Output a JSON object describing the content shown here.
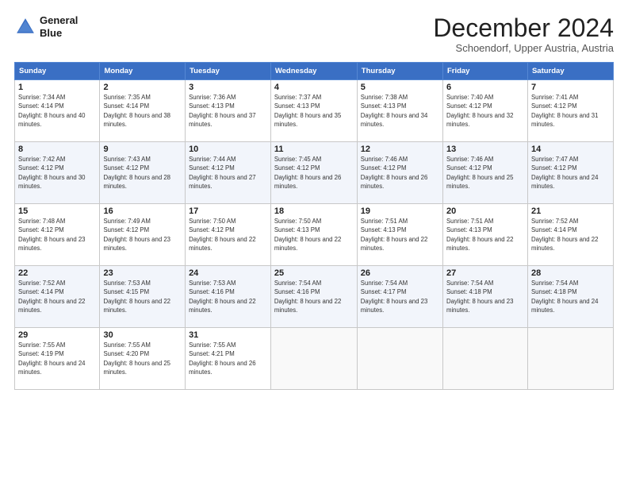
{
  "header": {
    "logo_line1": "General",
    "logo_line2": "Blue",
    "month": "December 2024",
    "location": "Schoendorf, Upper Austria, Austria"
  },
  "weekdays": [
    "Sunday",
    "Monday",
    "Tuesday",
    "Wednesday",
    "Thursday",
    "Friday",
    "Saturday"
  ],
  "rows": [
    [
      {
        "day": "1",
        "sunrise": "Sunrise: 7:34 AM",
        "sunset": "Sunset: 4:14 PM",
        "daylight": "Daylight: 8 hours and 40 minutes."
      },
      {
        "day": "2",
        "sunrise": "Sunrise: 7:35 AM",
        "sunset": "Sunset: 4:14 PM",
        "daylight": "Daylight: 8 hours and 38 minutes."
      },
      {
        "day": "3",
        "sunrise": "Sunrise: 7:36 AM",
        "sunset": "Sunset: 4:13 PM",
        "daylight": "Daylight: 8 hours and 37 minutes."
      },
      {
        "day": "4",
        "sunrise": "Sunrise: 7:37 AM",
        "sunset": "Sunset: 4:13 PM",
        "daylight": "Daylight: 8 hours and 35 minutes."
      },
      {
        "day": "5",
        "sunrise": "Sunrise: 7:38 AM",
        "sunset": "Sunset: 4:13 PM",
        "daylight": "Daylight: 8 hours and 34 minutes."
      },
      {
        "day": "6",
        "sunrise": "Sunrise: 7:40 AM",
        "sunset": "Sunset: 4:12 PM",
        "daylight": "Daylight: 8 hours and 32 minutes."
      },
      {
        "day": "7",
        "sunrise": "Sunrise: 7:41 AM",
        "sunset": "Sunset: 4:12 PM",
        "daylight": "Daylight: 8 hours and 31 minutes."
      }
    ],
    [
      {
        "day": "8",
        "sunrise": "Sunrise: 7:42 AM",
        "sunset": "Sunset: 4:12 PM",
        "daylight": "Daylight: 8 hours and 30 minutes."
      },
      {
        "day": "9",
        "sunrise": "Sunrise: 7:43 AM",
        "sunset": "Sunset: 4:12 PM",
        "daylight": "Daylight: 8 hours and 28 minutes."
      },
      {
        "day": "10",
        "sunrise": "Sunrise: 7:44 AM",
        "sunset": "Sunset: 4:12 PM",
        "daylight": "Daylight: 8 hours and 27 minutes."
      },
      {
        "day": "11",
        "sunrise": "Sunrise: 7:45 AM",
        "sunset": "Sunset: 4:12 PM",
        "daylight": "Daylight: 8 hours and 26 minutes."
      },
      {
        "day": "12",
        "sunrise": "Sunrise: 7:46 AM",
        "sunset": "Sunset: 4:12 PM",
        "daylight": "Daylight: 8 hours and 26 minutes."
      },
      {
        "day": "13",
        "sunrise": "Sunrise: 7:46 AM",
        "sunset": "Sunset: 4:12 PM",
        "daylight": "Daylight: 8 hours and 25 minutes."
      },
      {
        "day": "14",
        "sunrise": "Sunrise: 7:47 AM",
        "sunset": "Sunset: 4:12 PM",
        "daylight": "Daylight: 8 hours and 24 minutes."
      }
    ],
    [
      {
        "day": "15",
        "sunrise": "Sunrise: 7:48 AM",
        "sunset": "Sunset: 4:12 PM",
        "daylight": "Daylight: 8 hours and 23 minutes."
      },
      {
        "day": "16",
        "sunrise": "Sunrise: 7:49 AM",
        "sunset": "Sunset: 4:12 PM",
        "daylight": "Daylight: 8 hours and 23 minutes."
      },
      {
        "day": "17",
        "sunrise": "Sunrise: 7:50 AM",
        "sunset": "Sunset: 4:12 PM",
        "daylight": "Daylight: 8 hours and 22 minutes."
      },
      {
        "day": "18",
        "sunrise": "Sunrise: 7:50 AM",
        "sunset": "Sunset: 4:13 PM",
        "daylight": "Daylight: 8 hours and 22 minutes."
      },
      {
        "day": "19",
        "sunrise": "Sunrise: 7:51 AM",
        "sunset": "Sunset: 4:13 PM",
        "daylight": "Daylight: 8 hours and 22 minutes."
      },
      {
        "day": "20",
        "sunrise": "Sunrise: 7:51 AM",
        "sunset": "Sunset: 4:13 PM",
        "daylight": "Daylight: 8 hours and 22 minutes."
      },
      {
        "day": "21",
        "sunrise": "Sunrise: 7:52 AM",
        "sunset": "Sunset: 4:14 PM",
        "daylight": "Daylight: 8 hours and 22 minutes."
      }
    ],
    [
      {
        "day": "22",
        "sunrise": "Sunrise: 7:52 AM",
        "sunset": "Sunset: 4:14 PM",
        "daylight": "Daylight: 8 hours and 22 minutes."
      },
      {
        "day": "23",
        "sunrise": "Sunrise: 7:53 AM",
        "sunset": "Sunset: 4:15 PM",
        "daylight": "Daylight: 8 hours and 22 minutes."
      },
      {
        "day": "24",
        "sunrise": "Sunrise: 7:53 AM",
        "sunset": "Sunset: 4:16 PM",
        "daylight": "Daylight: 8 hours and 22 minutes."
      },
      {
        "day": "25",
        "sunrise": "Sunrise: 7:54 AM",
        "sunset": "Sunset: 4:16 PM",
        "daylight": "Daylight: 8 hours and 22 minutes."
      },
      {
        "day": "26",
        "sunrise": "Sunrise: 7:54 AM",
        "sunset": "Sunset: 4:17 PM",
        "daylight": "Daylight: 8 hours and 23 minutes."
      },
      {
        "day": "27",
        "sunrise": "Sunrise: 7:54 AM",
        "sunset": "Sunset: 4:18 PM",
        "daylight": "Daylight: 8 hours and 23 minutes."
      },
      {
        "day": "28",
        "sunrise": "Sunrise: 7:54 AM",
        "sunset": "Sunset: 4:18 PM",
        "daylight": "Daylight: 8 hours and 24 minutes."
      }
    ],
    [
      {
        "day": "29",
        "sunrise": "Sunrise: 7:55 AM",
        "sunset": "Sunset: 4:19 PM",
        "daylight": "Daylight: 8 hours and 24 minutes."
      },
      {
        "day": "30",
        "sunrise": "Sunrise: 7:55 AM",
        "sunset": "Sunset: 4:20 PM",
        "daylight": "Daylight: 8 hours and 25 minutes."
      },
      {
        "day": "31",
        "sunrise": "Sunrise: 7:55 AM",
        "sunset": "Sunset: 4:21 PM",
        "daylight": "Daylight: 8 hours and 26 minutes."
      },
      null,
      null,
      null,
      null
    ]
  ]
}
